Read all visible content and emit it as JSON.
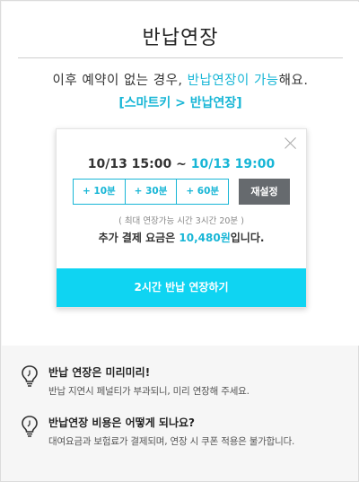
{
  "page": {
    "title": "반납연장",
    "message_prefix": "이후 예약이 없는 경우, ",
    "message_accent": "반납연장이 가능",
    "message_suffix": "해요.",
    "path": "[스마트키 > 반납연장]"
  },
  "card": {
    "time_from": "10/13 15:00",
    "time_sep": " ~ ",
    "time_to": "10/13 19:00",
    "extend_buttons": [
      "+ 10분",
      "+ 30분",
      "+ 60분"
    ],
    "reset_label": "재설정",
    "max_note": "( 최대 연장가능 시간 3시간 20분 )",
    "fee_prefix": "추가 결제 요금은 ",
    "fee_amount": "10,480원",
    "fee_suffix": "입니다.",
    "confirm_label": "2시간 반납 연장하기"
  },
  "faq": [
    {
      "question": "반납 연장은 미리미리!",
      "answer": "반납 지연시 페널티가 부과되니, 미리 연장해 주세요."
    },
    {
      "question": "반납연장 비용은 어떻게 되나요?",
      "answer": "대여요금과 보험료가 결제되며, 연장 시 쿠폰 적용은 불가합니다."
    }
  ],
  "colors": {
    "accent": "#18b6d6",
    "confirm_bg": "#0fd4f2",
    "reset_bg": "#666a6e"
  }
}
